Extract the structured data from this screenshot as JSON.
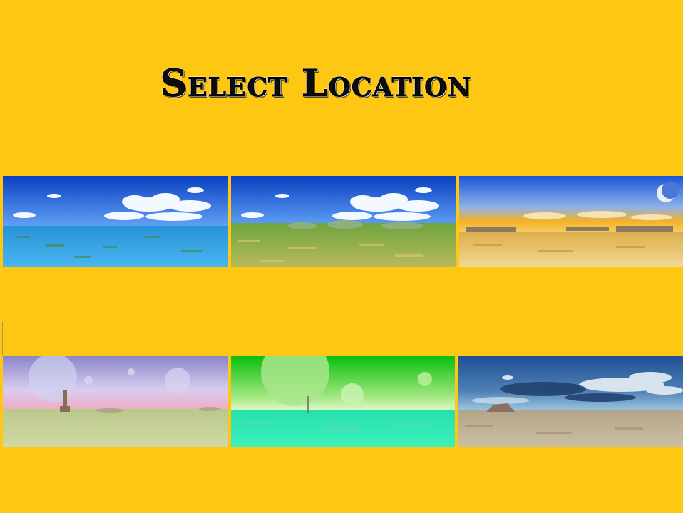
{
  "screen": {
    "background": "#fdc714",
    "title": "Select Location"
  },
  "locations": [
    {
      "name": "ocean",
      "sky": [
        "#0b3fc0",
        "#4f8ff0"
      ],
      "ground": [
        "#2d9bdc",
        "#4ab4ec"
      ],
      "feature": "clouds"
    },
    {
      "name": "grassland",
      "sky": [
        "#0b3fc0",
        "#4f8ff0"
      ],
      "ground": [
        "#6aa13a",
        "#c9c06a"
      ],
      "feature": "clouds"
    },
    {
      "name": "desert",
      "sky": [
        "#1a55d8",
        "#f3b020"
      ],
      "ground": [
        "#e0b24d",
        "#f0d590"
      ],
      "feature": "moon"
    },
    {
      "name": "alien-plains",
      "sky": [
        "#8a86c9",
        "#f2b8c8"
      ],
      "ground": [
        "#c7d19a",
        "#b5c07a"
      ],
      "feature": "moons"
    },
    {
      "name": "green-planet",
      "sky": [
        "#0abf10",
        "#d6f7b8"
      ],
      "ground": [
        "#2fe5b0",
        "#45efc0"
      ],
      "feature": "moons"
    },
    {
      "name": "wasteland",
      "sky": [
        "#1f4f95",
        "#9cc6df"
      ],
      "ground": [
        "#b7a98a",
        "#cdbf9f"
      ],
      "feature": "storm-clouds"
    }
  ]
}
